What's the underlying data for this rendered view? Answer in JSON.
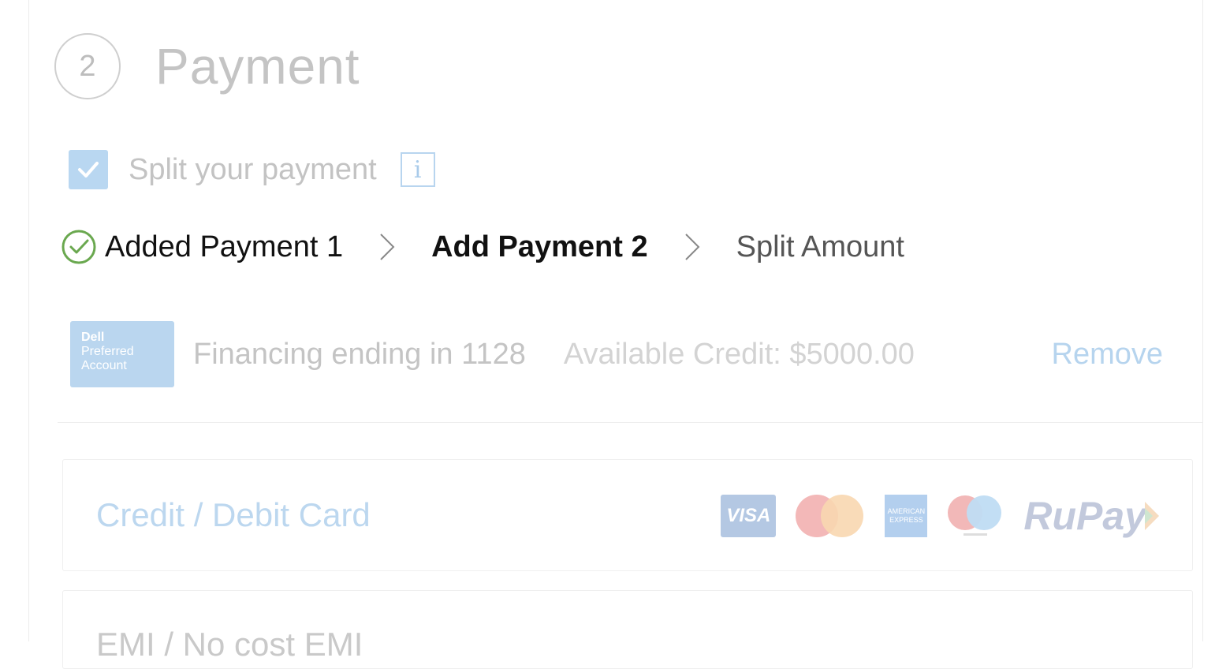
{
  "step": {
    "number": "2",
    "title": "Payment"
  },
  "split": {
    "checked": true,
    "label": "Split your payment",
    "info_icon": "info-icon"
  },
  "breadcrumb": {
    "items": [
      {
        "label": "Added Payment 1",
        "state": "done"
      },
      {
        "label": "Add Payment 2",
        "state": "active"
      },
      {
        "label": "Split Amount",
        "state": "upcoming"
      }
    ]
  },
  "saved_payment": {
    "logo": {
      "brand": "Dell",
      "line2": "Preferred",
      "line3": "Account"
    },
    "description": "Financing ending in 1128",
    "available_credit": "Available Credit: $5000.00",
    "remove_label": "Remove"
  },
  "methods": {
    "credit": {
      "label": "Credit / Debit Card",
      "cards": [
        "visa",
        "mastercard",
        "american-express",
        "maestro",
        "rupay"
      ],
      "visa_text": "VISA",
      "amex_text": "AMERICAN EXPRESS",
      "rupay_text": "RuPay"
    },
    "emi": {
      "label": "EMI / No cost EMI"
    }
  },
  "colors": {
    "accent_blue": "#b6d4ee",
    "check_green": "#6aa84f",
    "muted_text": "#c4c4c4"
  }
}
